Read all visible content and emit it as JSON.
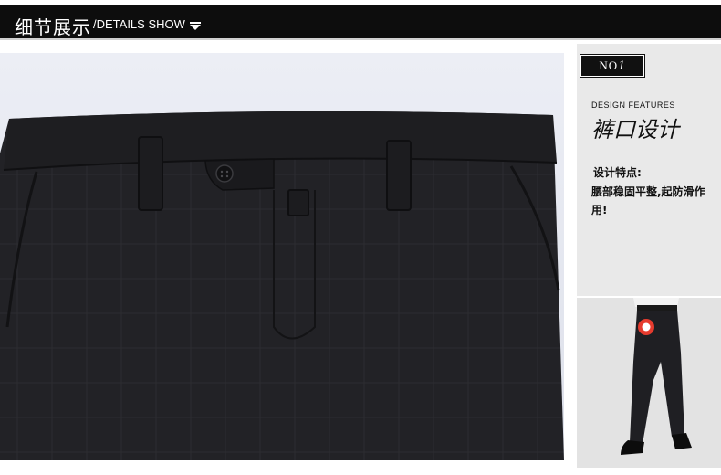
{
  "header": {
    "title": "细节展示",
    "subtitle": "/DETAILS SHOW",
    "arrow_icon": "chevron-down-icon"
  },
  "side": {
    "badge_prefix": "NO",
    "badge_number": "1",
    "features_en": "DESIGN FEATURES",
    "features_cn": "裤口设计",
    "desc_label": "设计特点:",
    "desc_body": "腰部稳固平整,起防滑作用!"
  },
  "colors": {
    "header_bg": "#0d0d0d",
    "fabric": "#232326",
    "panel_bg": "#e9e9e9",
    "marker": "#e63b2e"
  }
}
